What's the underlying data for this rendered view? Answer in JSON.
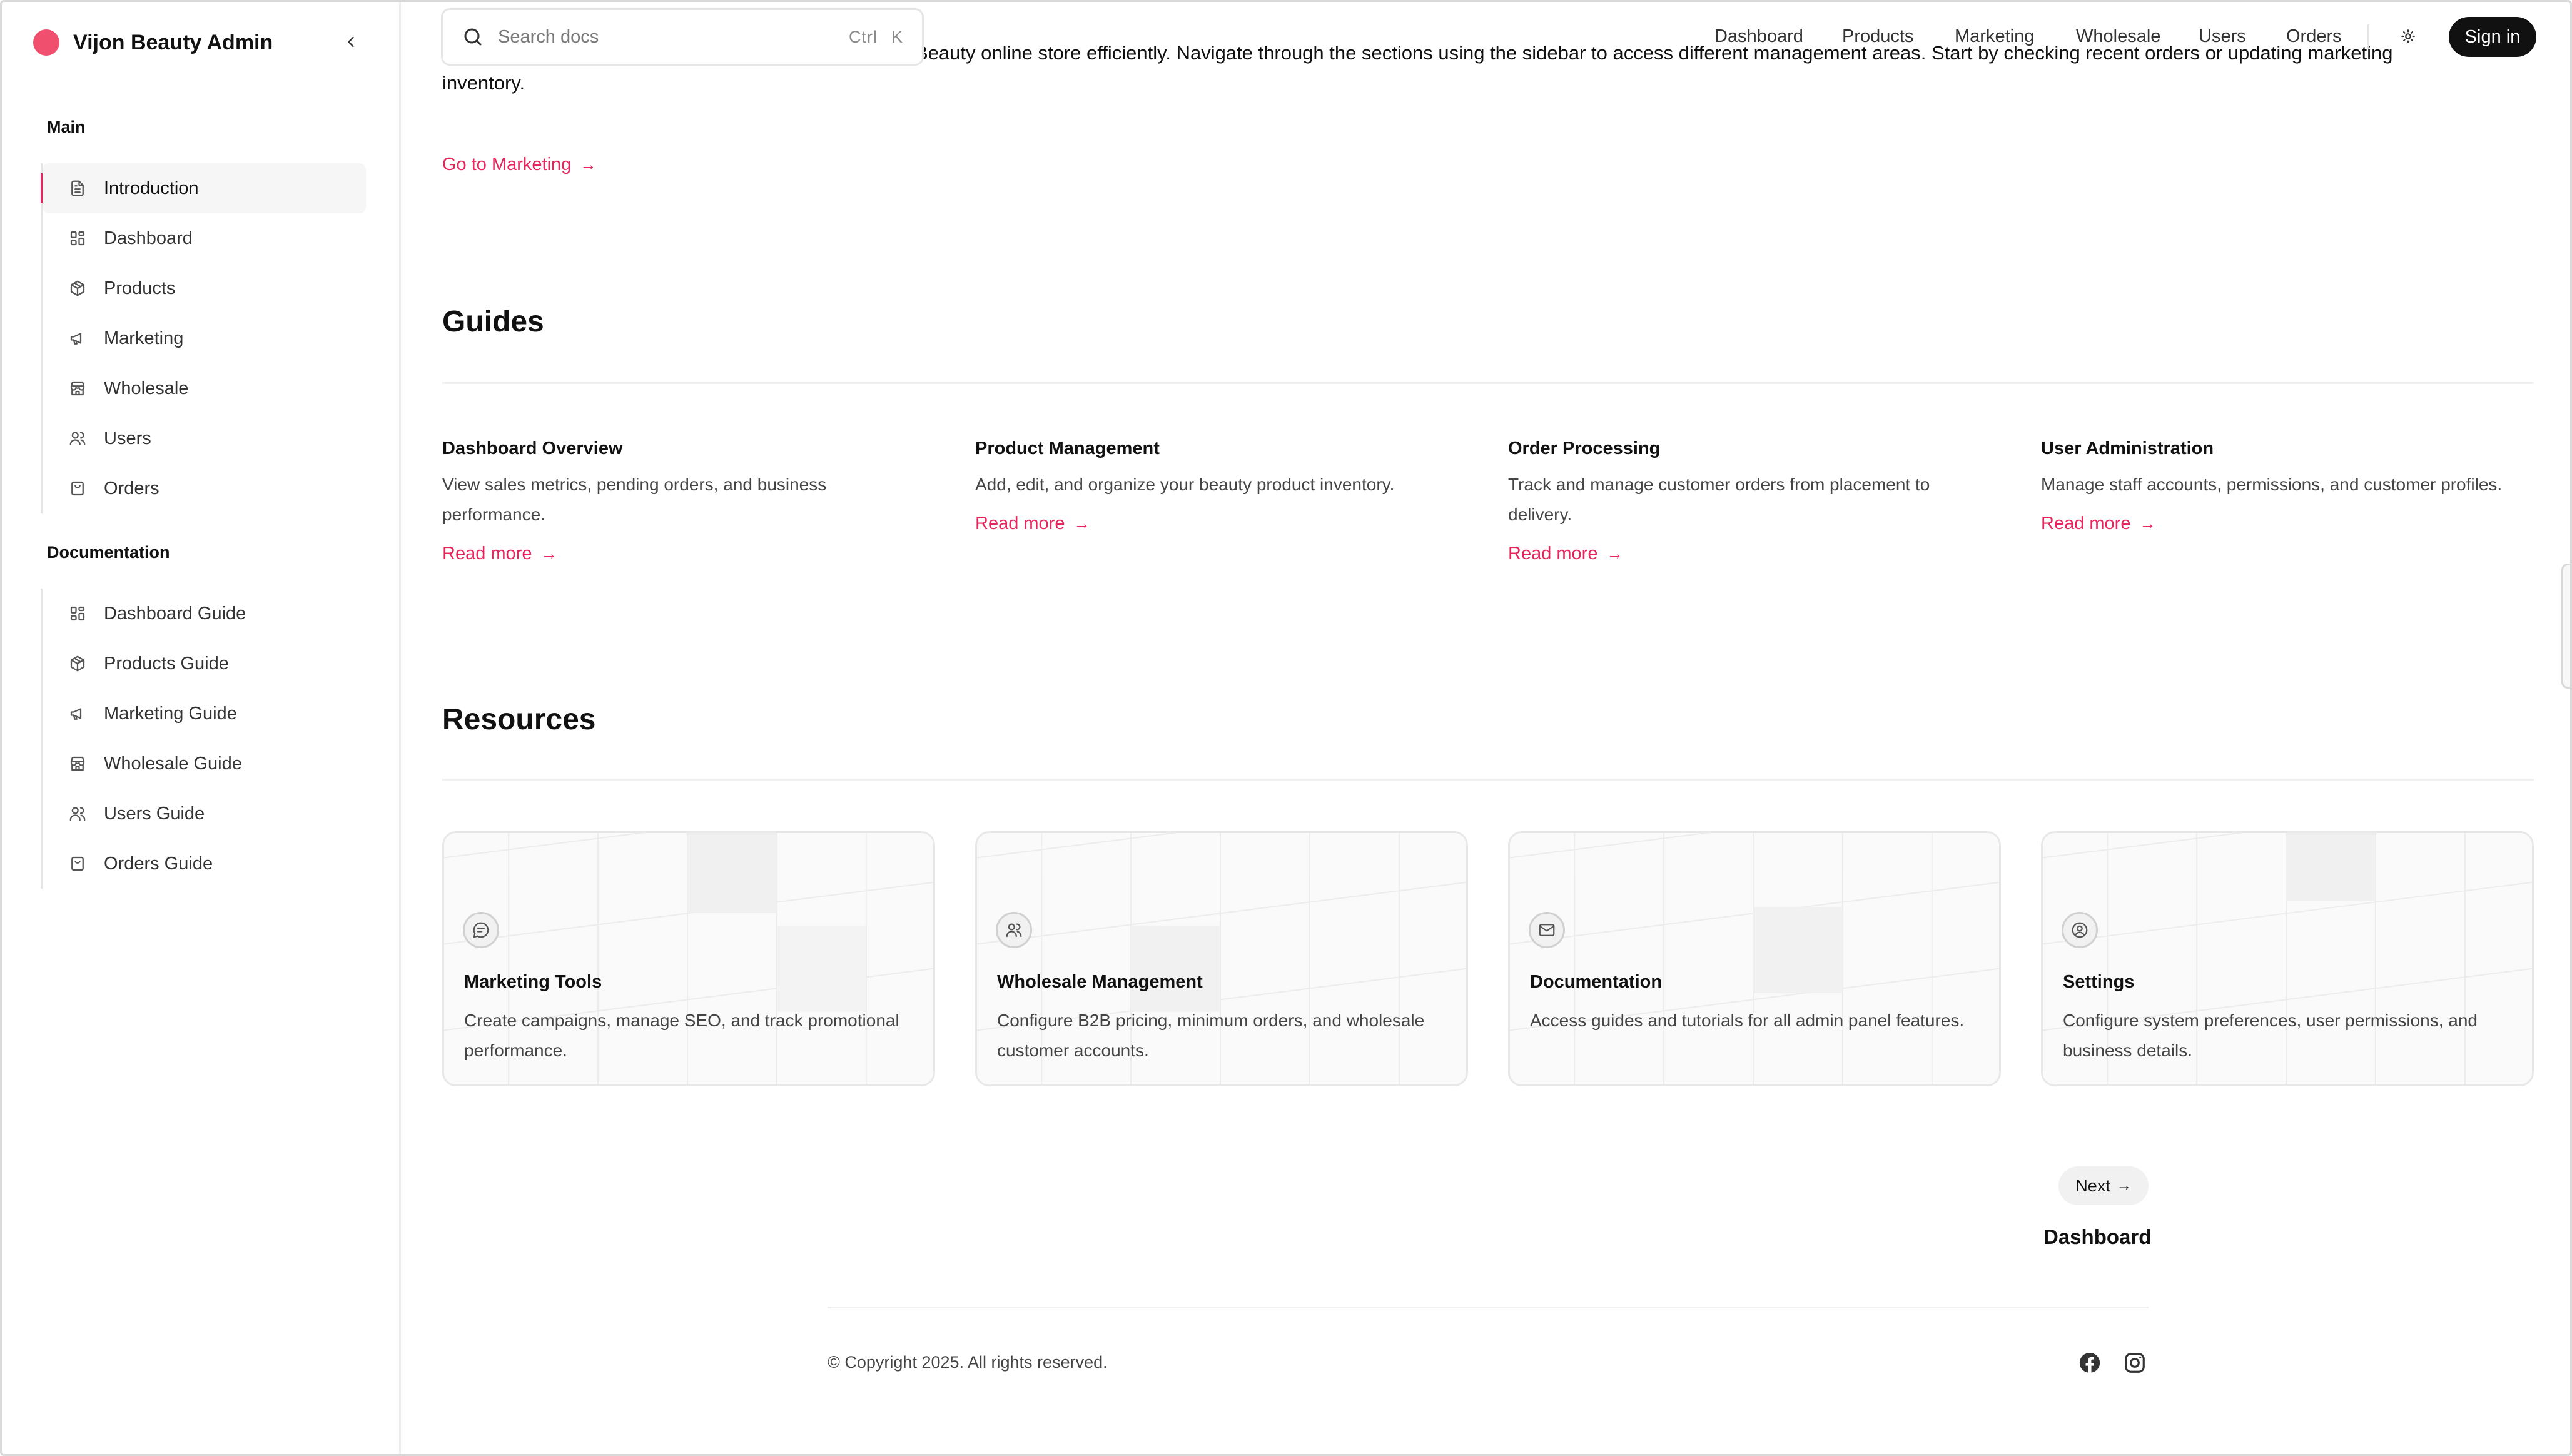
{
  "brand": {
    "name": "Vijon Beauty Admin",
    "accent_color": "#e8245d",
    "dot_color": "#f0506e"
  },
  "sidebar": {
    "main_title": "Main",
    "main_items": [
      {
        "label": "Introduction",
        "icon": "file-text-icon",
        "active": true
      },
      {
        "label": "Dashboard",
        "icon": "dashboard-icon"
      },
      {
        "label": "Products",
        "icon": "package-icon"
      },
      {
        "label": "Marketing",
        "icon": "megaphone-icon"
      },
      {
        "label": "Wholesale",
        "icon": "store-icon"
      },
      {
        "label": "Users",
        "icon": "users-icon"
      },
      {
        "label": "Orders",
        "icon": "shopping-bag-icon"
      }
    ],
    "docs_title": "Documentation",
    "docs_items": [
      {
        "label": "Dashboard Guide",
        "icon": "dashboard-icon"
      },
      {
        "label": "Products Guide",
        "icon": "package-icon"
      },
      {
        "label": "Marketing Guide",
        "icon": "megaphone-icon"
      },
      {
        "label": "Wholesale Guide",
        "icon": "store-icon"
      },
      {
        "label": "Users Guide",
        "icon": "users-icon"
      },
      {
        "label": "Orders Guide",
        "icon": "shopping-bag-icon"
      }
    ]
  },
  "search": {
    "placeholder": "Search docs",
    "shortcut_ctrl": "Ctrl",
    "shortcut_key": "K"
  },
  "topnav": {
    "items": [
      "Dashboard",
      "Products",
      "Marketing",
      "Wholesale",
      "Users",
      "Orders"
    ],
    "signin": "Sign in"
  },
  "intro": {
    "line1": "This panel provides the tools you need to run the Vijon Beauty online store efficiently. Navigate through the sections using the sidebar to access different management areas. Start by checking recent orders or updating marketing",
    "line2": "inventory.",
    "link": "Go to Marketing"
  },
  "guides": {
    "title": "Guides",
    "items": [
      {
        "title": "Dashboard Overview",
        "desc": "View sales metrics, pending orders, and business performance.",
        "link": "Read more"
      },
      {
        "title": "Product Management",
        "desc": "Add, edit, and organize your beauty product inventory.",
        "link": "Read more"
      },
      {
        "title": "Order Processing",
        "desc": "Track and manage customer orders from placement to delivery.",
        "link": "Read more"
      },
      {
        "title": "User Administration",
        "desc": "Manage staff accounts, permissions, and customer profiles.",
        "link": "Read more"
      }
    ]
  },
  "resources": {
    "title": "Resources",
    "items": [
      {
        "title": "Marketing Tools",
        "desc": "Create campaigns, manage SEO, and track promotional performance.",
        "icon": "chat-icon"
      },
      {
        "title": "Wholesale Management",
        "desc": "Configure B2B pricing, minimum orders, and wholesale customer accounts.",
        "icon": "users-icon"
      },
      {
        "title": "Documentation",
        "desc": "Access guides and tutorials for all admin panel features.",
        "icon": "mail-icon"
      },
      {
        "title": "Settings",
        "desc": "Configure system preferences, user permissions, and business details.",
        "icon": "user-circle-icon"
      }
    ]
  },
  "pagination": {
    "next_button": "Next",
    "next_page": "Dashboard"
  },
  "footer": {
    "copyright": "© Copyright 2025. All rights reserved.",
    "social": [
      "facebook-icon",
      "instagram-icon"
    ]
  }
}
